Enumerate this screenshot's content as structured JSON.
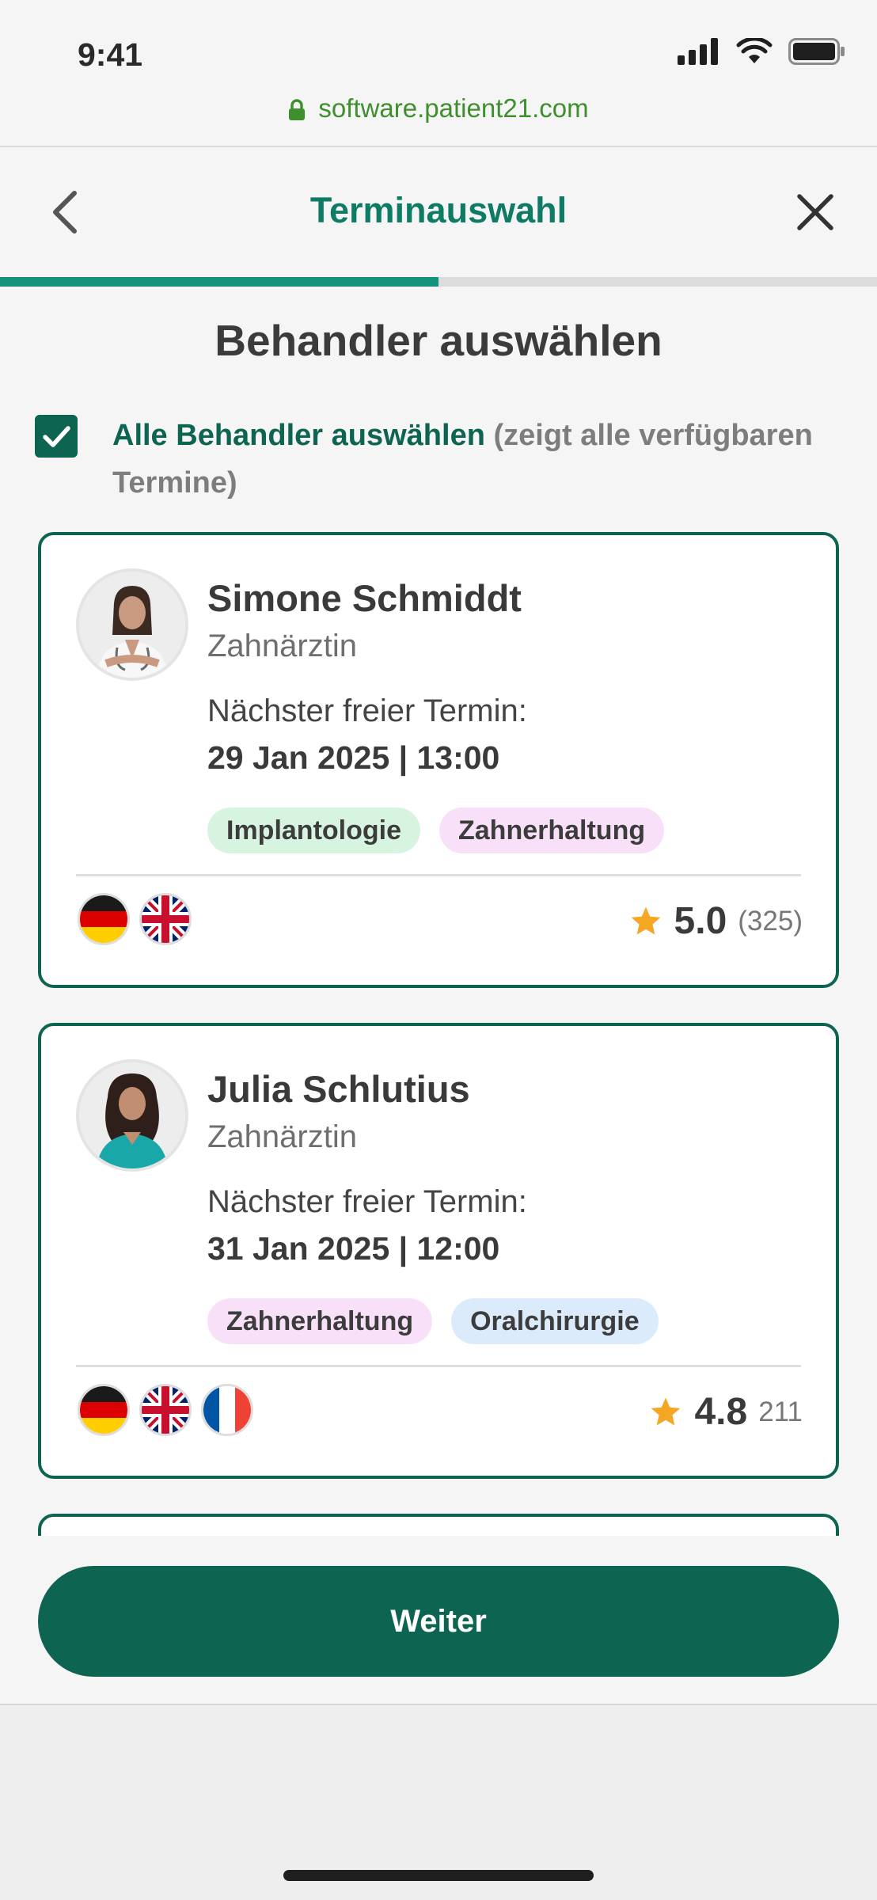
{
  "status_bar": {
    "time": "9:41"
  },
  "browser": {
    "url": "software.patient21.com"
  },
  "header": {
    "title": "Terminauswahl"
  },
  "progress": {
    "fraction": 0.5
  },
  "page": {
    "heading": "Behandler auswählen"
  },
  "select_all": {
    "checked": true,
    "label_strong": "Alle Behandler auswählen",
    "label_hint": "(zeigt alle verfügbaren Termine)"
  },
  "providers": [
    {
      "name": "Simone Schmiddt",
      "role": "Zahnärztin",
      "next_label": "Nächster freier Termin:",
      "next_value": "29 Jan 2025 | 13:00",
      "tags": [
        "Implantologie",
        "Zahnerhaltung"
      ],
      "languages": [
        "de-flag-icon",
        "gb-flag-icon"
      ],
      "rating": "5.0",
      "rating_count": "(325)"
    },
    {
      "name": "Julia Schlutius",
      "role": "Zahnärztin",
      "next_label": "Nächster freier Termin:",
      "next_value": "31 Jan 2025 | 12:00",
      "tags": [
        "Zahnerhaltung",
        "Oralchirurgie"
      ],
      "languages": [
        "de-flag-icon",
        "gb-flag-icon",
        "fr-flag-icon"
      ],
      "rating": "4.8",
      "rating_count": "211"
    }
  ],
  "footer": {
    "button_label": "Weiter"
  },
  "colors": {
    "brand": "#0d6450",
    "title_green": "#0e7c64",
    "progress": "#13937a",
    "star": "#f5a623",
    "url_green": "#3f8f2e"
  }
}
